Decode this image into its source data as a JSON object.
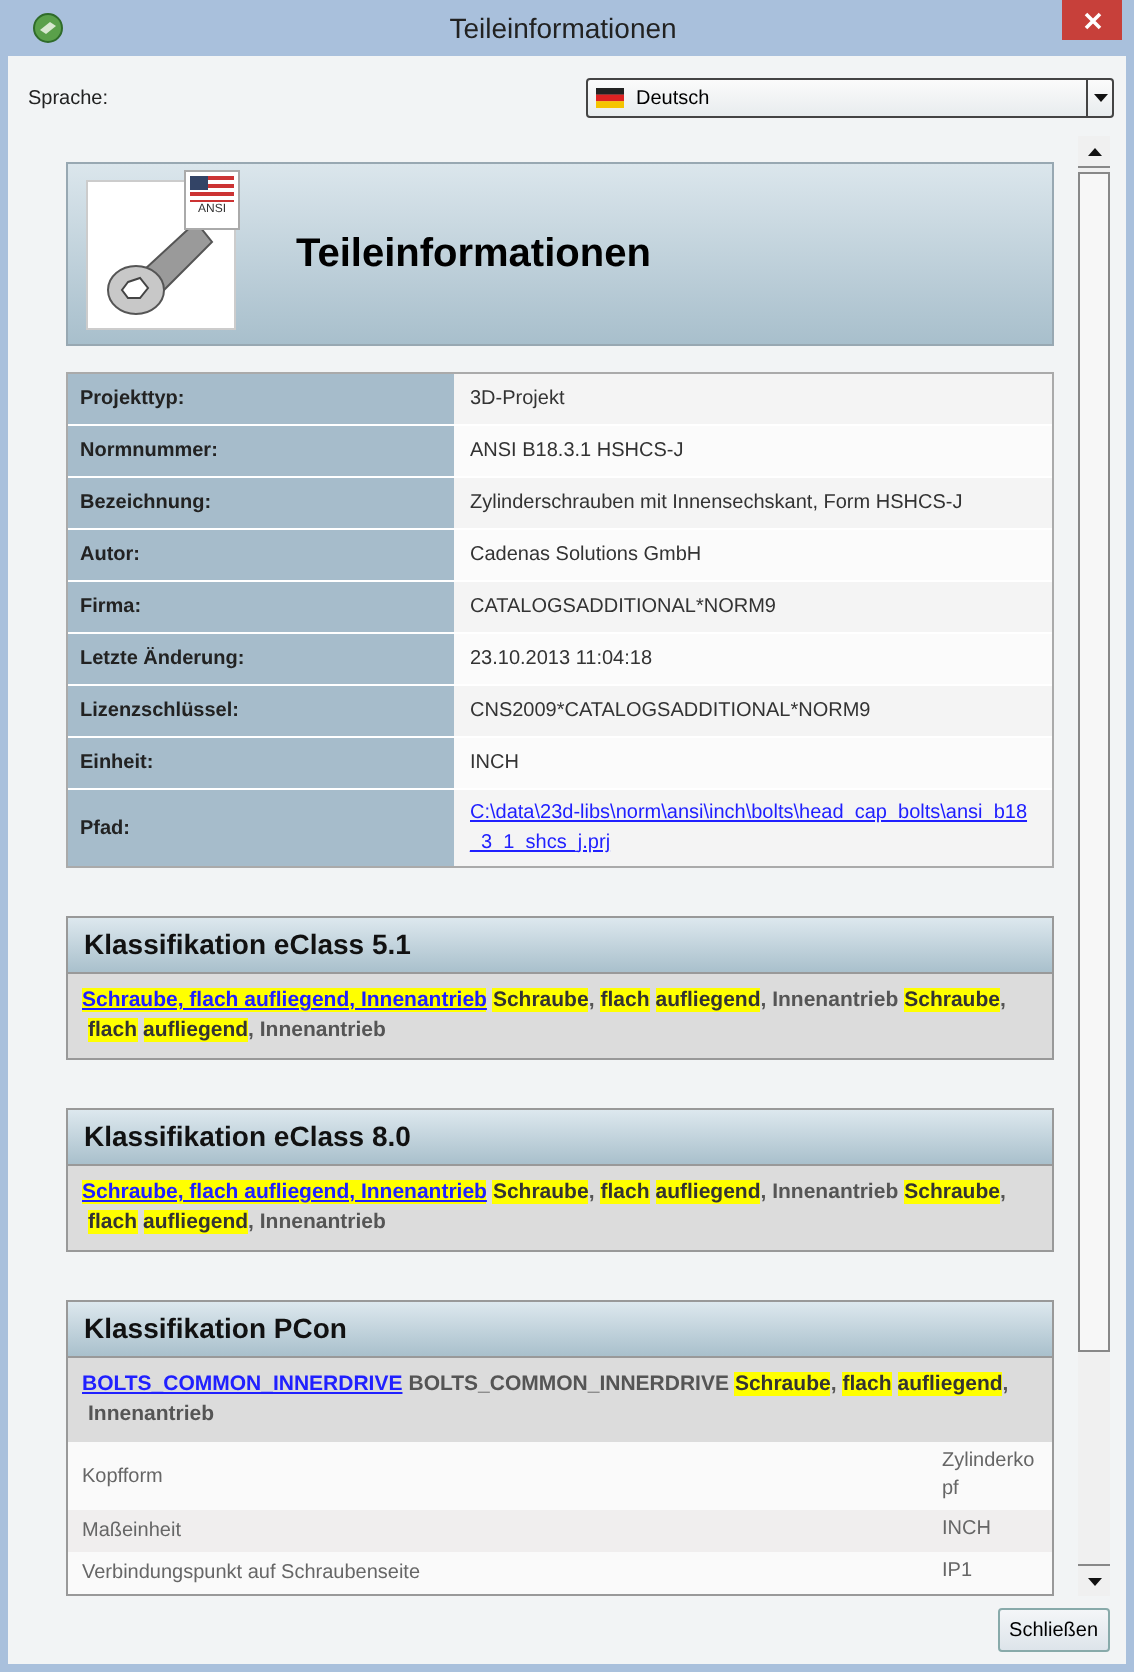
{
  "window": {
    "title": "Teileinformationen"
  },
  "language": {
    "label": "Sprache:",
    "value": "Deutsch"
  },
  "header": {
    "title": "Teileinformationen",
    "badge": "ANSI"
  },
  "properties": [
    {
      "label": "Projekttyp:",
      "value": "3D-Projekt",
      "kind": "text"
    },
    {
      "label": "Normnummer:",
      "value": "ANSI B18.3.1 HSHCS-J",
      "kind": "text"
    },
    {
      "label": "Bezeichnung:",
      "value": "Zylinderschrauben mit Innensechskant, Form HSHCS-J",
      "kind": "text"
    },
    {
      "label": "Autor:",
      "value": "Cadenas Solutions GmbH",
      "kind": "text"
    },
    {
      "label": "Firma:",
      "value": "CATALOGSADDITIONAL*NORM9",
      "kind": "text"
    },
    {
      "label": "Letzte Änderung:",
      "value": "23.10.2013 11:04:18",
      "kind": "text"
    },
    {
      "label": "Lizenzschlüssel:",
      "value": "CNS2009*CATALOGSADDITIONAL*NORM9",
      "kind": "text"
    },
    {
      "label": "Einheit:",
      "value": "INCH",
      "kind": "text"
    },
    {
      "label": "Pfad:",
      "value": "C:\\data\\23d-libs\\norm\\ansi\\inch\\bolts\\head_cap_bolts\\ansi_b18_3_1_shcs_j.prj",
      "kind": "link"
    }
  ],
  "classifications": [
    {
      "title": "Klassifikation eClass 5.1",
      "segments": [
        {
          "text": "Schraube, flach aufliegend, Innenantrieb",
          "kind": "link",
          "highlight": true
        },
        {
          "text": "Schraube",
          "kind": "text",
          "highlight": true,
          "attached": false
        },
        {
          "text": ",",
          "kind": "text",
          "highlight": false,
          "attached": true
        },
        {
          "text": "flach",
          "kind": "text",
          "highlight": true,
          "attached": false
        },
        {
          "text": "aufliegend",
          "kind": "text",
          "highlight": true,
          "attached": false
        },
        {
          "text": ", Innenantrieb",
          "kind": "text",
          "highlight": false,
          "attached": true
        },
        {
          "text": "Schraube",
          "kind": "text",
          "highlight": true,
          "attached": false
        },
        {
          "text": ",",
          "kind": "text",
          "highlight": false,
          "attached": true
        },
        {
          "text": "flach",
          "kind": "text",
          "highlight": true,
          "attached": false
        },
        {
          "text": "aufliegend",
          "kind": "text",
          "highlight": true,
          "attached": false
        },
        {
          "text": ", Innenantrieb",
          "kind": "text",
          "highlight": false,
          "attached": true
        }
      ]
    },
    {
      "title": "Klassifikation eClass 8.0",
      "segments": [
        {
          "text": "Schraube, flach aufliegend, Innenantrieb",
          "kind": "link",
          "highlight": true
        },
        {
          "text": "Schraube",
          "kind": "text",
          "highlight": true,
          "attached": false
        },
        {
          "text": ",",
          "kind": "text",
          "highlight": false,
          "attached": true
        },
        {
          "text": "flach",
          "kind": "text",
          "highlight": true,
          "attached": false
        },
        {
          "text": "aufliegend",
          "kind": "text",
          "highlight": true,
          "attached": false
        },
        {
          "text": ", Innenantrieb",
          "kind": "text",
          "highlight": false,
          "attached": true
        },
        {
          "text": "Schraube",
          "kind": "text",
          "highlight": true,
          "attached": false
        },
        {
          "text": ",",
          "kind": "text",
          "highlight": false,
          "attached": true
        },
        {
          "text": "flach",
          "kind": "text",
          "highlight": true,
          "attached": false
        },
        {
          "text": "aufliegend",
          "kind": "text",
          "highlight": true,
          "attached": false
        },
        {
          "text": ", Innenantrieb",
          "kind": "text",
          "highlight": false,
          "attached": true
        }
      ]
    },
    {
      "title": "Klassifikation PCon",
      "segments": [
        {
          "text": "BOLTS_COMMON_INNERDRIVE",
          "kind": "link",
          "highlight": false
        },
        {
          "text": "BOLTS_COMMON_INNERDRIVE",
          "kind": "text",
          "highlight": false,
          "attached": false
        },
        {
          "text": "Schraube",
          "kind": "text",
          "highlight": true,
          "attached": false
        },
        {
          "text": ",",
          "kind": "text",
          "highlight": false,
          "attached": true
        },
        {
          "text": "flach",
          "kind": "text",
          "highlight": true,
          "attached": false
        },
        {
          "text": "aufliegend",
          "kind": "text",
          "highlight": true,
          "attached": false
        },
        {
          "text": ",",
          "kind": "text",
          "highlight": false,
          "attached": true
        },
        {
          "text": "Innenantrieb",
          "kind": "text",
          "highlight": false,
          "attached": false
        }
      ],
      "attributes": [
        {
          "name": "Kopfform",
          "value": "Zylinderkopf"
        },
        {
          "name": "Maßeinheit",
          "value": "INCH"
        },
        {
          "name": "Verbindungspunkt auf Schraubenseite",
          "value": "IP1"
        }
      ]
    }
  ],
  "buttons": {
    "close": "Schließen"
  }
}
